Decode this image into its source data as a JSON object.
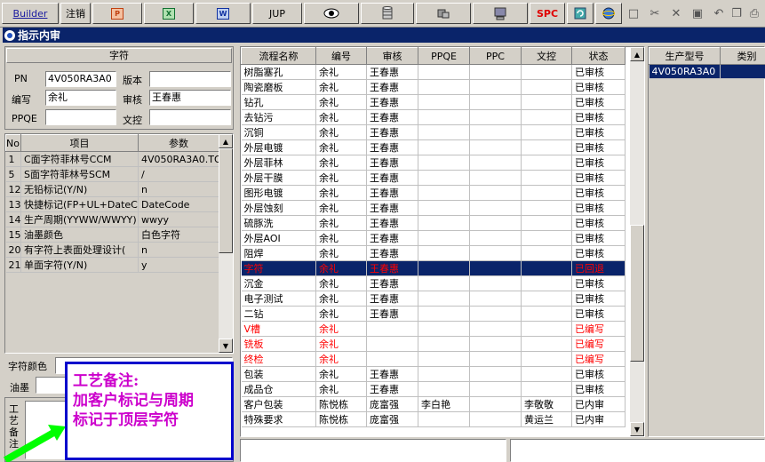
{
  "toolbar": {
    "builder_label": "Builder",
    "logout_label": "注销",
    "jump_label": "JUP",
    "spc_label": "SPC"
  },
  "window": {
    "title": "指示内审"
  },
  "char_panel": {
    "header": "字符",
    "pn_label": "PN",
    "pn_value": "4V050RA3A0",
    "version_label": "版本",
    "version_value": "",
    "author_label": "编写",
    "author_value": "余礼",
    "reviewer_label": "审核",
    "reviewer_value": "王春惠",
    "ppqe_label": "PPQE",
    "ppqe_value": "",
    "doc_label": "文控",
    "doc_value": ""
  },
  "param_table": {
    "headers": [
      "No",
      "项目",
      "参数"
    ],
    "rows": [
      {
        "no": "1",
        "item": "C面字符菲林号CCM",
        "param": "4V050RA3A0.TO"
      },
      {
        "no": "5",
        "item": "S面字符菲林号SCM",
        "param": "/"
      },
      {
        "no": "12",
        "item": "无铅标记(Y/N)",
        "param": "n"
      },
      {
        "no": "13",
        "item": "快捷标记(FP+UL+DateCo",
        "param": "DateCode"
      },
      {
        "no": "14",
        "item": "生产周期(YYWW/WWYY)",
        "param": "wwyy"
      },
      {
        "no": "15",
        "item": "油墨颜色",
        "param": "白色字符"
      },
      {
        "no": "20",
        "item": "有字符上表面处理设计(",
        "param": "n"
      },
      {
        "no": "21",
        "item": "单面字符(Y/N)",
        "param": "y"
      }
    ]
  },
  "bottom_left": {
    "char_color_label": "字符颜色",
    "ink_label": "油墨",
    "remark_label": "工艺备注"
  },
  "annotation": {
    "line1": "工艺备注:",
    "line2": "加客户标记与周期",
    "line3": "标记于顶层字符"
  },
  "process_table": {
    "headers": [
      "流程名称",
      "编号",
      "审核",
      "PPQE",
      "PPC",
      "文控",
      "状态"
    ],
    "rows": [
      {
        "name": "树脂塞孔",
        "code": "余礼",
        "review": "王春惠",
        "ppqe": "",
        "ppc": "",
        "doc": "",
        "status": "已审核",
        "style": "normal"
      },
      {
        "name": "陶瓷磨板",
        "code": "余礼",
        "review": "王春惠",
        "ppqe": "",
        "ppc": "",
        "doc": "",
        "status": "已审核",
        "style": "normal"
      },
      {
        "name": "钻孔",
        "code": "余礼",
        "review": "王春惠",
        "ppqe": "",
        "ppc": "",
        "doc": "",
        "status": "已审核",
        "style": "normal"
      },
      {
        "name": "去钻污",
        "code": "余礼",
        "review": "王春惠",
        "ppqe": "",
        "ppc": "",
        "doc": "",
        "status": "已审核",
        "style": "normal"
      },
      {
        "name": "沉铜",
        "code": "余礼",
        "review": "王春惠",
        "ppqe": "",
        "ppc": "",
        "doc": "",
        "status": "已审核",
        "style": "normal"
      },
      {
        "name": "外层电镀",
        "code": "余礼",
        "review": "王春惠",
        "ppqe": "",
        "ppc": "",
        "doc": "",
        "status": "已审核",
        "style": "normal"
      },
      {
        "name": "外层菲林",
        "code": "余礼",
        "review": "王春惠",
        "ppqe": "",
        "ppc": "",
        "doc": "",
        "status": "已审核",
        "style": "normal"
      },
      {
        "name": "外层干膜",
        "code": "余礼",
        "review": "王春惠",
        "ppqe": "",
        "ppc": "",
        "doc": "",
        "status": "已审核",
        "style": "normal"
      },
      {
        "name": "图形电镀",
        "code": "余礼",
        "review": "王春惠",
        "ppqe": "",
        "ppc": "",
        "doc": "",
        "status": "已审核",
        "style": "normal"
      },
      {
        "name": "外层蚀刻",
        "code": "余礼",
        "review": "王春惠",
        "ppqe": "",
        "ppc": "",
        "doc": "",
        "status": "已审核",
        "style": "normal"
      },
      {
        "name": "硫豚洗",
        "code": "余礼",
        "review": "王春惠",
        "ppqe": "",
        "ppc": "",
        "doc": "",
        "status": "已审核",
        "style": "normal"
      },
      {
        "name": "外层AOI",
        "code": "余礼",
        "review": "王春惠",
        "ppqe": "",
        "ppc": "",
        "doc": "",
        "status": "已审核",
        "style": "normal"
      },
      {
        "name": "阻焊",
        "code": "余礼",
        "review": "王春惠",
        "ppqe": "",
        "ppc": "",
        "doc": "",
        "status": "已审核",
        "style": "normal"
      },
      {
        "name": "字符",
        "code": "余礼",
        "review": "王春惠",
        "ppqe": "",
        "ppc": "",
        "doc": "",
        "status": "已回退",
        "style": "selected"
      },
      {
        "name": "沉金",
        "code": "余礼",
        "review": "王春惠",
        "ppqe": "",
        "ppc": "",
        "doc": "",
        "status": "已审核",
        "style": "normal"
      },
      {
        "name": "电子测试",
        "code": "余礼",
        "review": "王春惠",
        "ppqe": "",
        "ppc": "",
        "doc": "",
        "status": "已审核",
        "style": "normal"
      },
      {
        "name": "二钻",
        "code": "余礼",
        "review": "王春惠",
        "ppqe": "",
        "ppc": "",
        "doc": "",
        "status": "已审核",
        "style": "normal"
      },
      {
        "name": "V槽",
        "code": "余礼",
        "review": "",
        "ppqe": "",
        "ppc": "",
        "doc": "",
        "status": "已编写",
        "style": "red"
      },
      {
        "name": "铣板",
        "code": "余礼",
        "review": "",
        "ppqe": "",
        "ppc": "",
        "doc": "",
        "status": "已编写",
        "style": "red"
      },
      {
        "name": "终检",
        "code": "余礼",
        "review": "",
        "ppqe": "",
        "ppc": "",
        "doc": "",
        "status": "已编写",
        "style": "red"
      },
      {
        "name": "包装",
        "code": "余礼",
        "review": "王春惠",
        "ppqe": "",
        "ppc": "",
        "doc": "",
        "status": "已审核",
        "style": "normal"
      },
      {
        "name": "成品仓",
        "code": "余礼",
        "review": "王春惠",
        "ppqe": "",
        "ppc": "",
        "doc": "",
        "status": "已审核",
        "style": "normal"
      },
      {
        "name": "客户包装",
        "code": "陈悦栋",
        "review": "庞富强",
        "ppqe": "李白艳",
        "ppc": "",
        "doc": "李敬敬",
        "status": "已内审",
        "style": "normal"
      },
      {
        "name": "特殊要求",
        "code": "陈悦栋",
        "review": "庞富强",
        "ppqe": "",
        "ppc": "",
        "doc": "黄运兰",
        "status": "已内审",
        "style": "normal"
      }
    ]
  },
  "model_table": {
    "headers": [
      "生产型号",
      "类别"
    ],
    "rows": [
      {
        "model": "4V050RA3A0",
        "category": ""
      }
    ]
  },
  "colors": {
    "selection": "#0a246a",
    "red_text": "#ff0000",
    "annotation_border": "#0000cc",
    "annotation_text": "#cc00cc",
    "arrow": "#00ff00"
  }
}
